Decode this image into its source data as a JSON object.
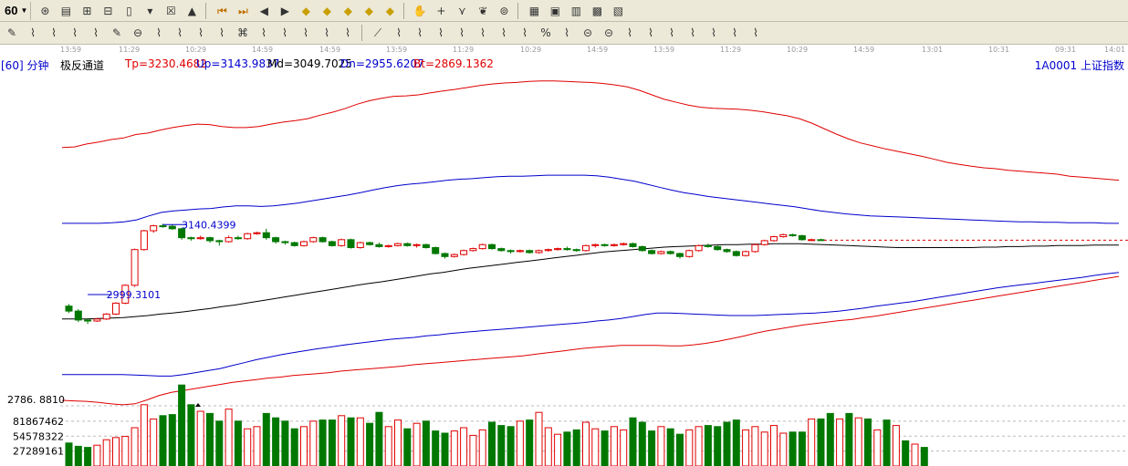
{
  "toolbar": {
    "period": "60",
    "row1_icons": [
      "tool-icon-1",
      "tool-icon-2",
      "tool-icon-3",
      "tool-icon-4",
      "tool-icon-5",
      "tool-icon-6",
      "tool-icon-7",
      "tool-icon-8",
      "first-bar-icon",
      "last-bar-icon",
      "move-left-icon",
      "move-right-icon",
      "zoom-in-icon",
      "zoom-out-icon",
      "zoom-in-more-icon",
      "zoom-out-more-icon",
      "zoom-reset-icon",
      "pan-hand-icon",
      "crosshair-icon",
      "indicator-icon",
      "stock-icon",
      "network-icon",
      "calendar-icon",
      "calculator-icon",
      "notes-icon",
      "save-icon",
      "print-icon"
    ],
    "row2_icons": [
      "pencil-icon",
      "draw-1-icon",
      "draw-2-icon",
      "draw-3-icon",
      "draw-4-icon",
      "draw-5-icon",
      "circle-icon",
      "draw-6-icon",
      "draw-7-icon",
      "draw-8-icon",
      "draw-9-icon",
      "draw-10-icon",
      "draw-11-icon",
      "draw-12-icon",
      "draw-13-icon",
      "draw-14-icon",
      "fib-icon",
      "fan-icon",
      "draw-15-icon",
      "draw-16-icon",
      "draw-17-icon",
      "draw-18-icon",
      "draw-19-icon",
      "draw-20-icon",
      "draw-21-icon",
      "percent-icon",
      "draw-22-icon",
      "draw-23-icon",
      "draw-24-icon",
      "draw-25-icon",
      "draw-26-icon",
      "draw-27-icon",
      "draw-28-icon",
      "draw-29-icon",
      "draw-30-icon",
      "draw-31-icon"
    ]
  },
  "time_ticks": [
    "13:59",
    "11:29",
    "10:29",
    "14:59",
    "14:59",
    "13:59",
    "11:29",
    "10:29",
    "14:59",
    "13:59",
    "11:29",
    "10:29",
    "14:59",
    "13:01",
    "10:31",
    "09:31",
    "14:01"
  ],
  "header": {
    "period_label": "[60] 分钟",
    "indicator_name": "极反通道",
    "tp": "Tp=3230.4682",
    "up": "Up=3143.9837",
    "md": "Md=3049.7025",
    "dn": "Dn=2955.6207",
    "bt": "Bt=2869.1362",
    "security": "1A0001  上证指数"
  },
  "colors": {
    "up_candle": "#e00000",
    "down_candle": "#007800",
    "tp_bt_line": "#e00000",
    "up_dn_line": "#0000cc",
    "md_line": "#000000",
    "grid": "#bbbbbb"
  },
  "chart_data": [
    {
      "type": "line",
      "title": "极反通道",
      "candles": [
        [
          2976,
          2980,
          2962,
          2966
        ],
        [
          2966,
          2970,
          2944,
          2948
        ],
        [
          2948,
          2950,
          2940,
          2946
        ],
        [
          2946,
          2952,
          2944,
          2950
        ],
        [
          2950,
          2962,
          2948,
          2960
        ],
        [
          2960,
          2984,
          2958,
          2982
        ],
        [
          2982,
          3020,
          2980,
          3018
        ],
        [
          3018,
          3092,
          3015,
          3090
        ],
        [
          3090,
          3130,
          3088,
          3128
        ],
        [
          3128,
          3140,
          3124,
          3138
        ],
        [
          3138,
          3142,
          3134,
          3137
        ],
        [
          3137,
          3140,
          3130,
          3132
        ],
        [
          3132,
          3134,
          3110,
          3114
        ],
        [
          3114,
          3116,
          3108,
          3112
        ],
        [
          3112,
          3118,
          3110,
          3114
        ],
        [
          3114,
          3116,
          3104,
          3108
        ],
        [
          3108,
          3110,
          3098,
          3106
        ],
        [
          3106,
          3118,
          3104,
          3114
        ],
        [
          3114,
          3118,
          3110,
          3112
        ],
        [
          3112,
          3124,
          3110,
          3122
        ],
        [
          3122,
          3126,
          3120,
          3124
        ],
        [
          3124,
          3132,
          3110,
          3114
        ],
        [
          3114,
          3116,
          3102,
          3106
        ],
        [
          3106,
          3108,
          3100,
          3104
        ],
        [
          3104,
          3106,
          3096,
          3098
        ],
        [
          3098,
          3108,
          3096,
          3106
        ],
        [
          3106,
          3116,
          3104,
          3114
        ],
        [
          3114,
          3116,
          3104,
          3106
        ],
        [
          3106,
          3108,
          3096,
          3098
        ],
        [
          3098,
          3112,
          3096,
          3110
        ],
        [
          3110,
          3112,
          3092,
          3094
        ],
        [
          3094,
          3106,
          3092,
          3104
        ],
        [
          3104,
          3106,
          3098,
          3100
        ],
        [
          3100,
          3104,
          3094,
          3096
        ],
        [
          3096,
          3100,
          3094,
          3098
        ],
        [
          3098,
          3104,
          3096,
          3102
        ],
        [
          3102,
          3104,
          3096,
          3098
        ],
        [
          3098,
          3102,
          3094,
          3100
        ],
        [
          3100,
          3102,
          3092,
          3094
        ],
        [
          3094,
          3096,
          3080,
          3082
        ],
        [
          3082,
          3084,
          3072,
          3076
        ],
        [
          3076,
          3082,
          3074,
          3080
        ],
        [
          3080,
          3090,
          3078,
          3088
        ],
        [
          3088,
          3094,
          3086,
          3092
        ],
        [
          3092,
          3102,
          3090,
          3100
        ],
        [
          3100,
          3102,
          3090,
          3092
        ],
        [
          3092,
          3094,
          3086,
          3088
        ],
        [
          3088,
          3090,
          3082,
          3086
        ],
        [
          3086,
          3090,
          3084,
          3088
        ],
        [
          3088,
          3090,
          3082,
          3084
        ],
        [
          3084,
          3090,
          3082,
          3088
        ],
        [
          3088,
          3092,
          3086,
          3090
        ],
        [
          3090,
          3094,
          3088,
          3092
        ],
        [
          3092,
          3096,
          3088,
          3090
        ],
        [
          3090,
          3092,
          3086,
          3088
        ],
        [
          3088,
          3100,
          3086,
          3098
        ],
        [
          3098,
          3102,
          3094,
          3100
        ],
        [
          3100,
          3102,
          3096,
          3098
        ],
        [
          3098,
          3102,
          3096,
          3100
        ],
        [
          3100,
          3104,
          3098,
          3102
        ],
        [
          3102,
          3104,
          3094,
          3096
        ],
        [
          3096,
          3098,
          3086,
          3088
        ],
        [
          3088,
          3090,
          3080,
          3082
        ],
        [
          3082,
          3088,
          3080,
          3086
        ],
        [
          3086,
          3088,
          3080,
          3082
        ],
        [
          3082,
          3084,
          3072,
          3076
        ],
        [
          3076,
          3090,
          3074,
          3088
        ],
        [
          3088,
          3100,
          3086,
          3098
        ],
        [
          3098,
          3102,
          3094,
          3096
        ],
        [
          3096,
          3098,
          3088,
          3090
        ],
        [
          3090,
          3092,
          3084,
          3086
        ],
        [
          3086,
          3088,
          3076,
          3078
        ],
        [
          3078,
          3088,
          3076,
          3086
        ],
        [
          3086,
          3102,
          3084,
          3100
        ],
        [
          3100,
          3110,
          3098,
          3108
        ],
        [
          3108,
          3118,
          3106,
          3116
        ],
        [
          3116,
          3122,
          3114,
          3120
        ],
        [
          3120,
          3122,
          3116,
          3118
        ],
        [
          3118,
          3120,
          3108,
          3110
        ],
        [
          3110,
          3112,
          3108,
          3110
        ],
        [
          3110,
          3112,
          3108,
          3109
        ]
      ],
      "series": [
        {
          "name": "Tp",
          "values": [
            3296,
            3297,
            3303,
            3307,
            3312,
            3315,
            3322,
            3325,
            3331,
            3336,
            3340,
            3343,
            3342,
            3338,
            3336,
            3336,
            3338,
            3343,
            3347,
            3350,
            3354,
            3361,
            3367,
            3374,
            3383,
            3390,
            3395,
            3399,
            3400,
            3402,
            3406,
            3410,
            3413,
            3417,
            3421,
            3424,
            3426,
            3427,
            3429,
            3430,
            3430,
            3429,
            3428,
            3427,
            3425,
            3422,
            3418,
            3411,
            3402,
            3393,
            3387,
            3381,
            3377,
            3375,
            3374,
            3373,
            3371,
            3368,
            3364,
            3360,
            3354,
            3345,
            3334,
            3323,
            3313,
            3305,
            3299,
            3293,
            3288,
            3283,
            3278,
            3272,
            3266,
            3262,
            3258,
            3255,
            3253,
            3250,
            3248,
            3246,
            3244,
            3242,
            3238,
            3236,
            3234,
            3232,
            3230
          ]
        },
        {
          "name": "Up",
          "values": [
            3143,
            3143,
            3143,
            3143,
            3144,
            3146,
            3150,
            3158,
            3165,
            3168,
            3170,
            3172,
            3173,
            3176,
            3178,
            3178,
            3177,
            3178,
            3181,
            3184,
            3188,
            3192,
            3196,
            3200,
            3205,
            3210,
            3215,
            3219,
            3222,
            3224,
            3227,
            3230,
            3232,
            3233,
            3235,
            3237,
            3238,
            3238,
            3239,
            3240,
            3240,
            3240,
            3240,
            3239,
            3236,
            3232,
            3228,
            3222,
            3216,
            3210,
            3205,
            3201,
            3197,
            3194,
            3191,
            3188,
            3185,
            3182,
            3179,
            3176,
            3172,
            3168,
            3165,
            3162,
            3160,
            3158,
            3157,
            3156,
            3155,
            3154,
            3153,
            3152,
            3151,
            3150,
            3149,
            3148,
            3147,
            3146,
            3146,
            3145,
            3145,
            3144,
            3144,
            3144,
            3143,
            3143
          ]
        },
        {
          "name": "Md",
          "values": [
            2950,
            2950,
            2950,
            2951,
            2952,
            2953,
            2955,
            2957,
            2960,
            2962,
            2965,
            2968,
            2971,
            2975,
            2978,
            2982,
            2986,
            2990,
            2994,
            2998,
            3002,
            3006,
            3010,
            3014,
            3018,
            3022,
            3025,
            3029,
            3033,
            3037,
            3041,
            3044,
            3048,
            3052,
            3055,
            3058,
            3061,
            3064,
            3067,
            3070,
            3073,
            3076,
            3079,
            3082,
            3085,
            3087,
            3089,
            3091,
            3093,
            3095,
            3096,
            3097,
            3098,
            3099,
            3100,
            3100,
            3101,
            3101,
            3102,
            3102,
            3102,
            3101,
            3100,
            3099,
            3098,
            3097,
            3096,
            3095,
            3094,
            3094,
            3094,
            3094,
            3094,
            3094,
            3094,
            3095,
            3095,
            3096,
            3096,
            3097,
            3097,
            3098,
            3098,
            3098,
            3099,
            3099,
            3099
          ]
        },
        {
          "name": "Dn",
          "values": [
            2838,
            2838,
            2838,
            2838,
            2838,
            2838,
            2837,
            2836,
            2835,
            2835,
            2838,
            2842,
            2846,
            2850,
            2856,
            2862,
            2868,
            2873,
            2878,
            2882,
            2886,
            2890,
            2893,
            2897,
            2900,
            2903,
            2906,
            2909,
            2911,
            2913,
            2916,
            2918,
            2921,
            2923,
            2925,
            2927,
            2929,
            2931,
            2933,
            2935,
            2937,
            2939,
            2941,
            2943,
            2946,
            2948,
            2951,
            2955,
            2959,
            2962,
            2962,
            2961,
            2960,
            2959,
            2958,
            2957,
            2957,
            2957,
            2958,
            2959,
            2960,
            2961,
            2962,
            2964,
            2966,
            2969,
            2972,
            2976,
            2979,
            2982,
            2985,
            2989,
            2993,
            2997,
            3001,
            3005,
            3009,
            3013,
            3016,
            3019,
            3022,
            3025,
            3028,
            3031,
            3034,
            3038,
            3041,
            3044
          ]
        },
        {
          "name": "Bt",
          "values": [
            2786,
            2785,
            2784,
            2782,
            2779,
            2777,
            2779,
            2787,
            2796,
            2802,
            2806,
            2810,
            2814,
            2818,
            2822,
            2825,
            2828,
            2831,
            2833,
            2836,
            2838,
            2840,
            2842,
            2845,
            2847,
            2849,
            2851,
            2853,
            2855,
            2858,
            2860,
            2862,
            2864,
            2866,
            2868,
            2870,
            2872,
            2874,
            2876,
            2879,
            2882,
            2885,
            2888,
            2891,
            2893,
            2895,
            2897,
            2897,
            2897,
            2897,
            2896,
            2896,
            2898,
            2901,
            2905,
            2910,
            2915,
            2921,
            2926,
            2930,
            2934,
            2938,
            2941,
            2944,
            2947,
            2949,
            2953,
            2956,
            2960,
            2964,
            2968,
            2972,
            2976,
            2980,
            2984,
            2988,
            2992,
            2996,
            3000,
            3004,
            3008,
            3012,
            3016,
            3020,
            3024,
            3028,
            3032,
            3036
          ]
        }
      ],
      "annotations": [
        {
          "label": "3140.4399",
          "bar": 10,
          "value": 3140.4399
        },
        {
          "label": "2999.3101",
          "bar": 2,
          "value": 2999.3101
        }
      ],
      "ylabel_left": "2786. 8810"
    },
    {
      "type": "bar",
      "title": "",
      "yticks": [
        81867462,
        54578322,
        27289161
      ],
      "ytick_labels": [
        "81867462",
        "54578322",
        "27289161"
      ],
      "ylim": [
        0,
        110000000
      ],
      "values": [
        42,
        36,
        34,
        38,
        48,
        52,
        54,
        70,
        112,
        86,
        92,
        94,
        148,
        112,
        100,
        96,
        82,
        104,
        82,
        68,
        72,
        96,
        88,
        82,
        68,
        72,
        82,
        84,
        84,
        92,
        88,
        88,
        78,
        98,
        72,
        84,
        68,
        78,
        82,
        64,
        60,
        64,
        70,
        56,
        66,
        80,
        74,
        72,
        82,
        84,
        98,
        70,
        58,
        62,
        66,
        80,
        68,
        64,
        72,
        66,
        88,
        80,
        64,
        72,
        68,
        58,
        66,
        72,
        74,
        72,
        80,
        84,
        66,
        72,
        62,
        74,
        60,
        62,
        62,
        86,
        86,
        96,
        86,
        96,
        88,
        86,
        66,
        84,
        74,
        46,
        40,
        34
      ]
    }
  ]
}
